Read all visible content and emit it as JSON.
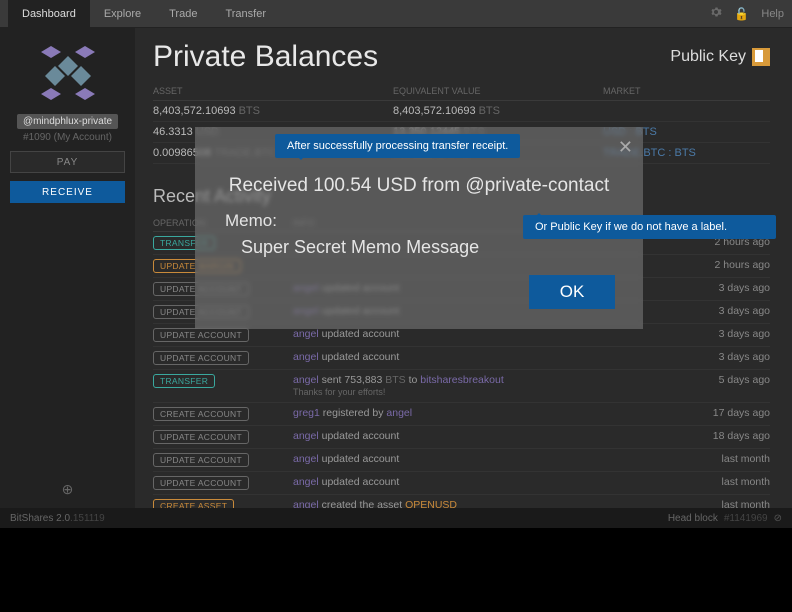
{
  "topbar": {
    "tabs": [
      "Dashboard",
      "Explore",
      "Trade",
      "Transfer"
    ],
    "help": "Help"
  },
  "sidebar": {
    "username": "@mindphlux-private",
    "acctid": "#1090 (My Account)",
    "pay": "PAY",
    "receive": "RECEIVE"
  },
  "page": {
    "title": "Private Balances",
    "pubkey": "Public Key"
  },
  "balhead": {
    "asset": "ASSET",
    "equiv": "EQUIVALENT VALUE",
    "market": "MARKET"
  },
  "balances": [
    {
      "amt": "8,403,572.10693",
      "sym": "BTS",
      "eamt": "8,403,572.10693",
      "esym": "BTS",
      "mkt": ""
    },
    {
      "amt": "46.3313",
      "sym": "USD",
      "eamt": "13,350.12445",
      "esym": "BTS",
      "mkt": "USD : BTS"
    },
    {
      "amt": "0.00986508",
      "sym": "TRADE.BTC",
      "eamt": "759.21249",
      "esym": "BTS",
      "mkt": "TRADE.BTC : BTS"
    }
  ],
  "recent": {
    "title": "Recent Activity",
    "op": "OPERATION",
    "info": "INFO",
    "date": "DATE"
  },
  "tx": [
    {
      "pill": "TRANSFER",
      "pclass": "p-teal",
      "info": "",
      "date": "2 hours ago"
    },
    {
      "pill": "UPDATE MARGIN",
      "pclass": "p-orange",
      "info": "",
      "date": "2 hours ago"
    },
    {
      "pill": "UPDATE ACCOUNT",
      "pclass": "p-grey",
      "info": "<span class='user'>angel</span> updated account",
      "date": "3 days ago"
    },
    {
      "pill": "UPDATE ACCOUNT",
      "pclass": "p-grey",
      "info": "<span class='user'>angel</span> updated account",
      "date": "3 days ago"
    },
    {
      "pill": "UPDATE ACCOUNT",
      "pclass": "p-grey",
      "info": "<span class='user'>angel</span> updated account",
      "date": "3 days ago"
    },
    {
      "pill": "UPDATE ACCOUNT",
      "pclass": "p-grey",
      "info": "<span class='user'>angel</span> updated account",
      "date": "3 days ago"
    },
    {
      "pill": "TRANSFER",
      "pclass": "p-teal",
      "info": "<span class='user'>angel</span> sent 753,883 <span style='color:#666'>BTS</span> to <span class='user'>bitsharesbreakout</span><br><span class='sub'>Thanks for your efforts!</span>",
      "date": "5 days ago"
    },
    {
      "pill": "CREATE ACCOUNT",
      "pclass": "p-grey",
      "info": "<span class='user'>greg1</span> registered by <span class='user'>angel</span>",
      "date": "17 days ago"
    },
    {
      "pill": "UPDATE ACCOUNT",
      "pclass": "p-grey",
      "info": "<span class='user'>angel</span> updated account",
      "date": "18 days ago"
    },
    {
      "pill": "UPDATE ACCOUNT",
      "pclass": "p-grey",
      "info": "<span class='user'>angel</span> updated account",
      "date": "last month"
    },
    {
      "pill": "UPDATE ACCOUNT",
      "pclass": "p-grey",
      "info": "<span class='user'>angel</span> updated account",
      "date": "last month"
    },
    {
      "pill": "CREATE ASSET",
      "pclass": "p-orange",
      "info": "<span class='user'>angel</span> created the asset <span style='color:#c98a3a'>OPENUSD</span>",
      "date": "last month"
    }
  ],
  "modal": {
    "headline": "Received 100.54 USD from @private-contact",
    "memo_label": "Memo:",
    "memo": "Super Secret Memo Message",
    "ok": "OK"
  },
  "callout1": "After successfully processing transfer receipt.",
  "callout2": "Or Public Key if we do not have a label.",
  "footer": {
    "app": "BitShares 2.0",
    "ver": ".151119",
    "head": "Head block",
    "block": "#1141969"
  }
}
